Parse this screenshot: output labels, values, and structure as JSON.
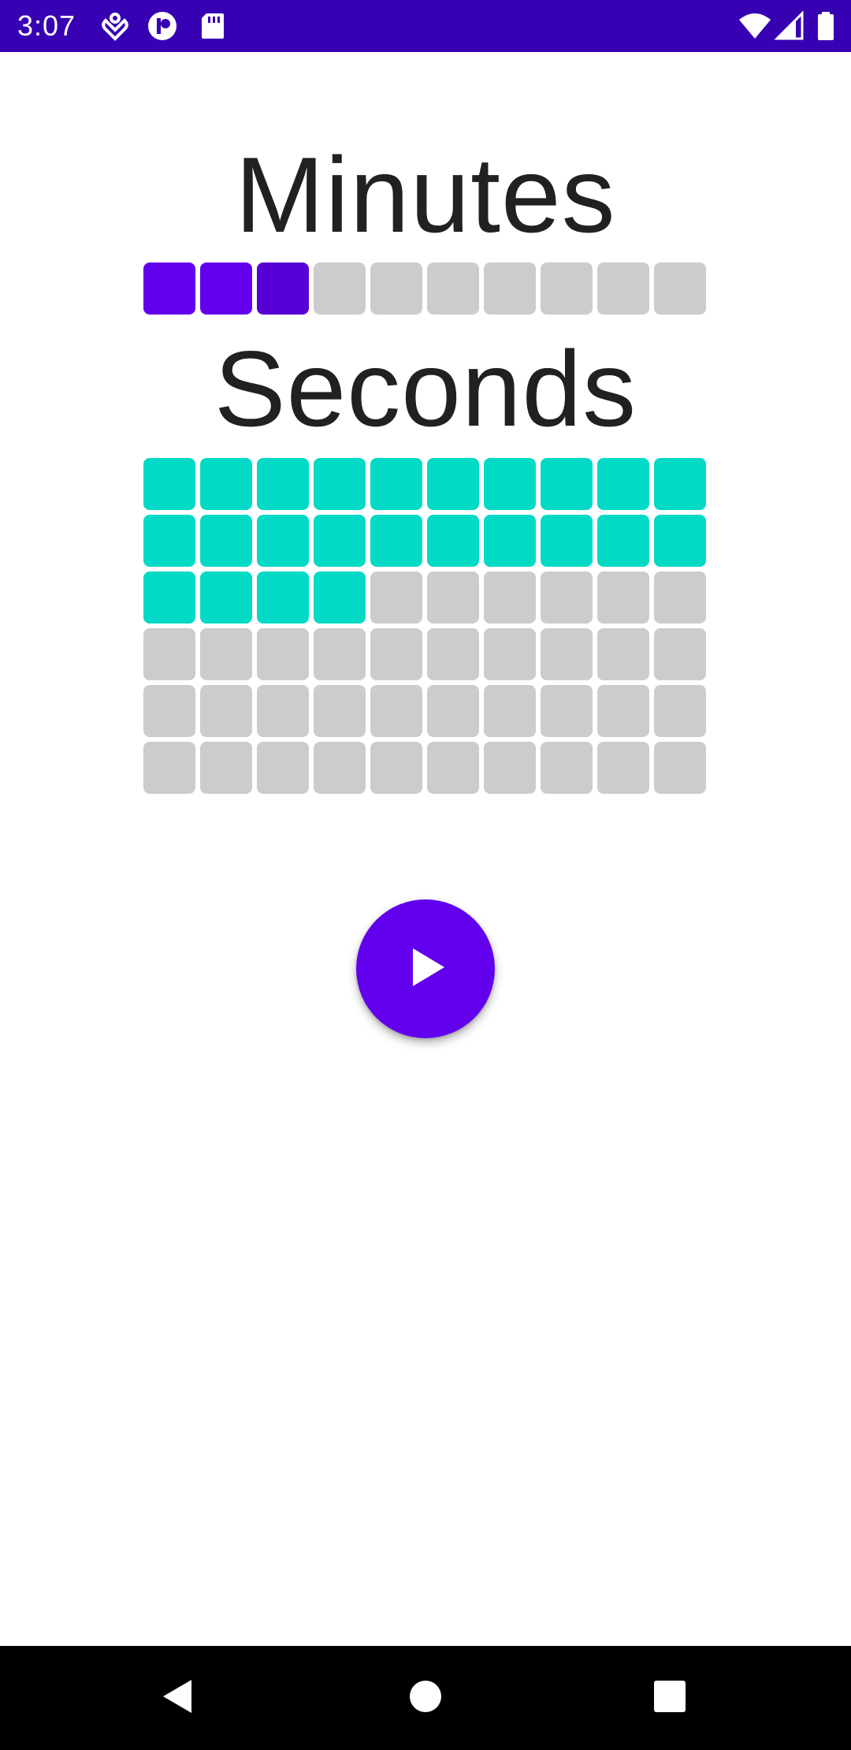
{
  "status_bar": {
    "time": "3:07",
    "background": "#3700b3",
    "left_icons": [
      "notification-icon",
      "app-icon",
      "sd-card-icon"
    ],
    "right_icons": [
      "wifi-icon",
      "signal-icon",
      "battery-icon"
    ]
  },
  "minutes": {
    "title": "Minutes",
    "total_cells": 10,
    "filled_cells": 3,
    "active_color": "#6200ee",
    "inactive_color": "#cccccc"
  },
  "seconds": {
    "title": "Seconds",
    "total_cells": 60,
    "filled_cells": 24,
    "active_color": "#03dac5",
    "inactive_color": "#cccccc"
  },
  "play_button": {
    "icon": "play-icon",
    "color": "#6200ee"
  },
  "nav_bar": {
    "buttons": [
      "back-icon",
      "home-icon",
      "recents-icon"
    ]
  }
}
